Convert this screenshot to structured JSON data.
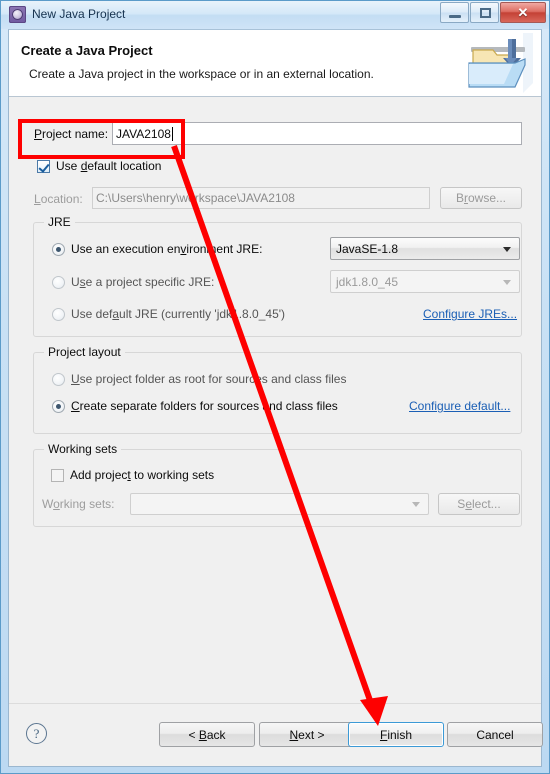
{
  "window": {
    "title": "New Java Project",
    "icon": "eclipse-wizard-icon",
    "controls": {
      "minimize": "minimize-icon",
      "maximize": "maximize-icon",
      "close": "✕"
    }
  },
  "wizard_header": {
    "title": "Create a Java Project",
    "subtitle": "Create a Java project in the workspace or in an external location.",
    "banner_icon": "java-project-folder-icon"
  },
  "project_name": {
    "label": "Project name:",
    "value": "JAVA2108",
    "placeholder": ""
  },
  "location": {
    "use_default_label": "Use default location",
    "use_default_checked": true,
    "label": "Location:",
    "value": "C:\\Users\\henry\\workspace\\JAVA2108",
    "browse_label": "Browse..."
  },
  "jre": {
    "group_title": "JRE",
    "options": [
      {
        "label": "Use an execution environment JRE:",
        "selected": true
      },
      {
        "label": "Use a project specific JRE:",
        "selected": false
      },
      {
        "label": "Use default JRE (currently 'jdk1.8.0_45')",
        "selected": false
      }
    ],
    "execution_environment_value": "JavaSE-1.8",
    "project_specific_value": "jdk1.8.0_45",
    "configure_link": "Configure JREs..."
  },
  "project_layout": {
    "group_title": "Project layout",
    "options": [
      {
        "label": "Use project folder as root for sources and class files",
        "selected": false
      },
      {
        "label": "Create separate folders for sources and class files",
        "selected": true
      }
    ],
    "configure_link": "Configure default..."
  },
  "working_sets": {
    "group_title": "Working sets",
    "add_label": "Add project to working sets",
    "add_checked": false,
    "label": "Working sets:",
    "value": "",
    "select_label": "Select..."
  },
  "buttons": {
    "help": "?",
    "back": "< Back",
    "next": "Next >",
    "finish": "Finish",
    "cancel": "Cancel"
  },
  "annotations": {
    "highlight_target": "project-name-row",
    "arrow_color": "#fe0000",
    "arrow_from": "project-name-field",
    "arrow_to": "finish-button"
  }
}
